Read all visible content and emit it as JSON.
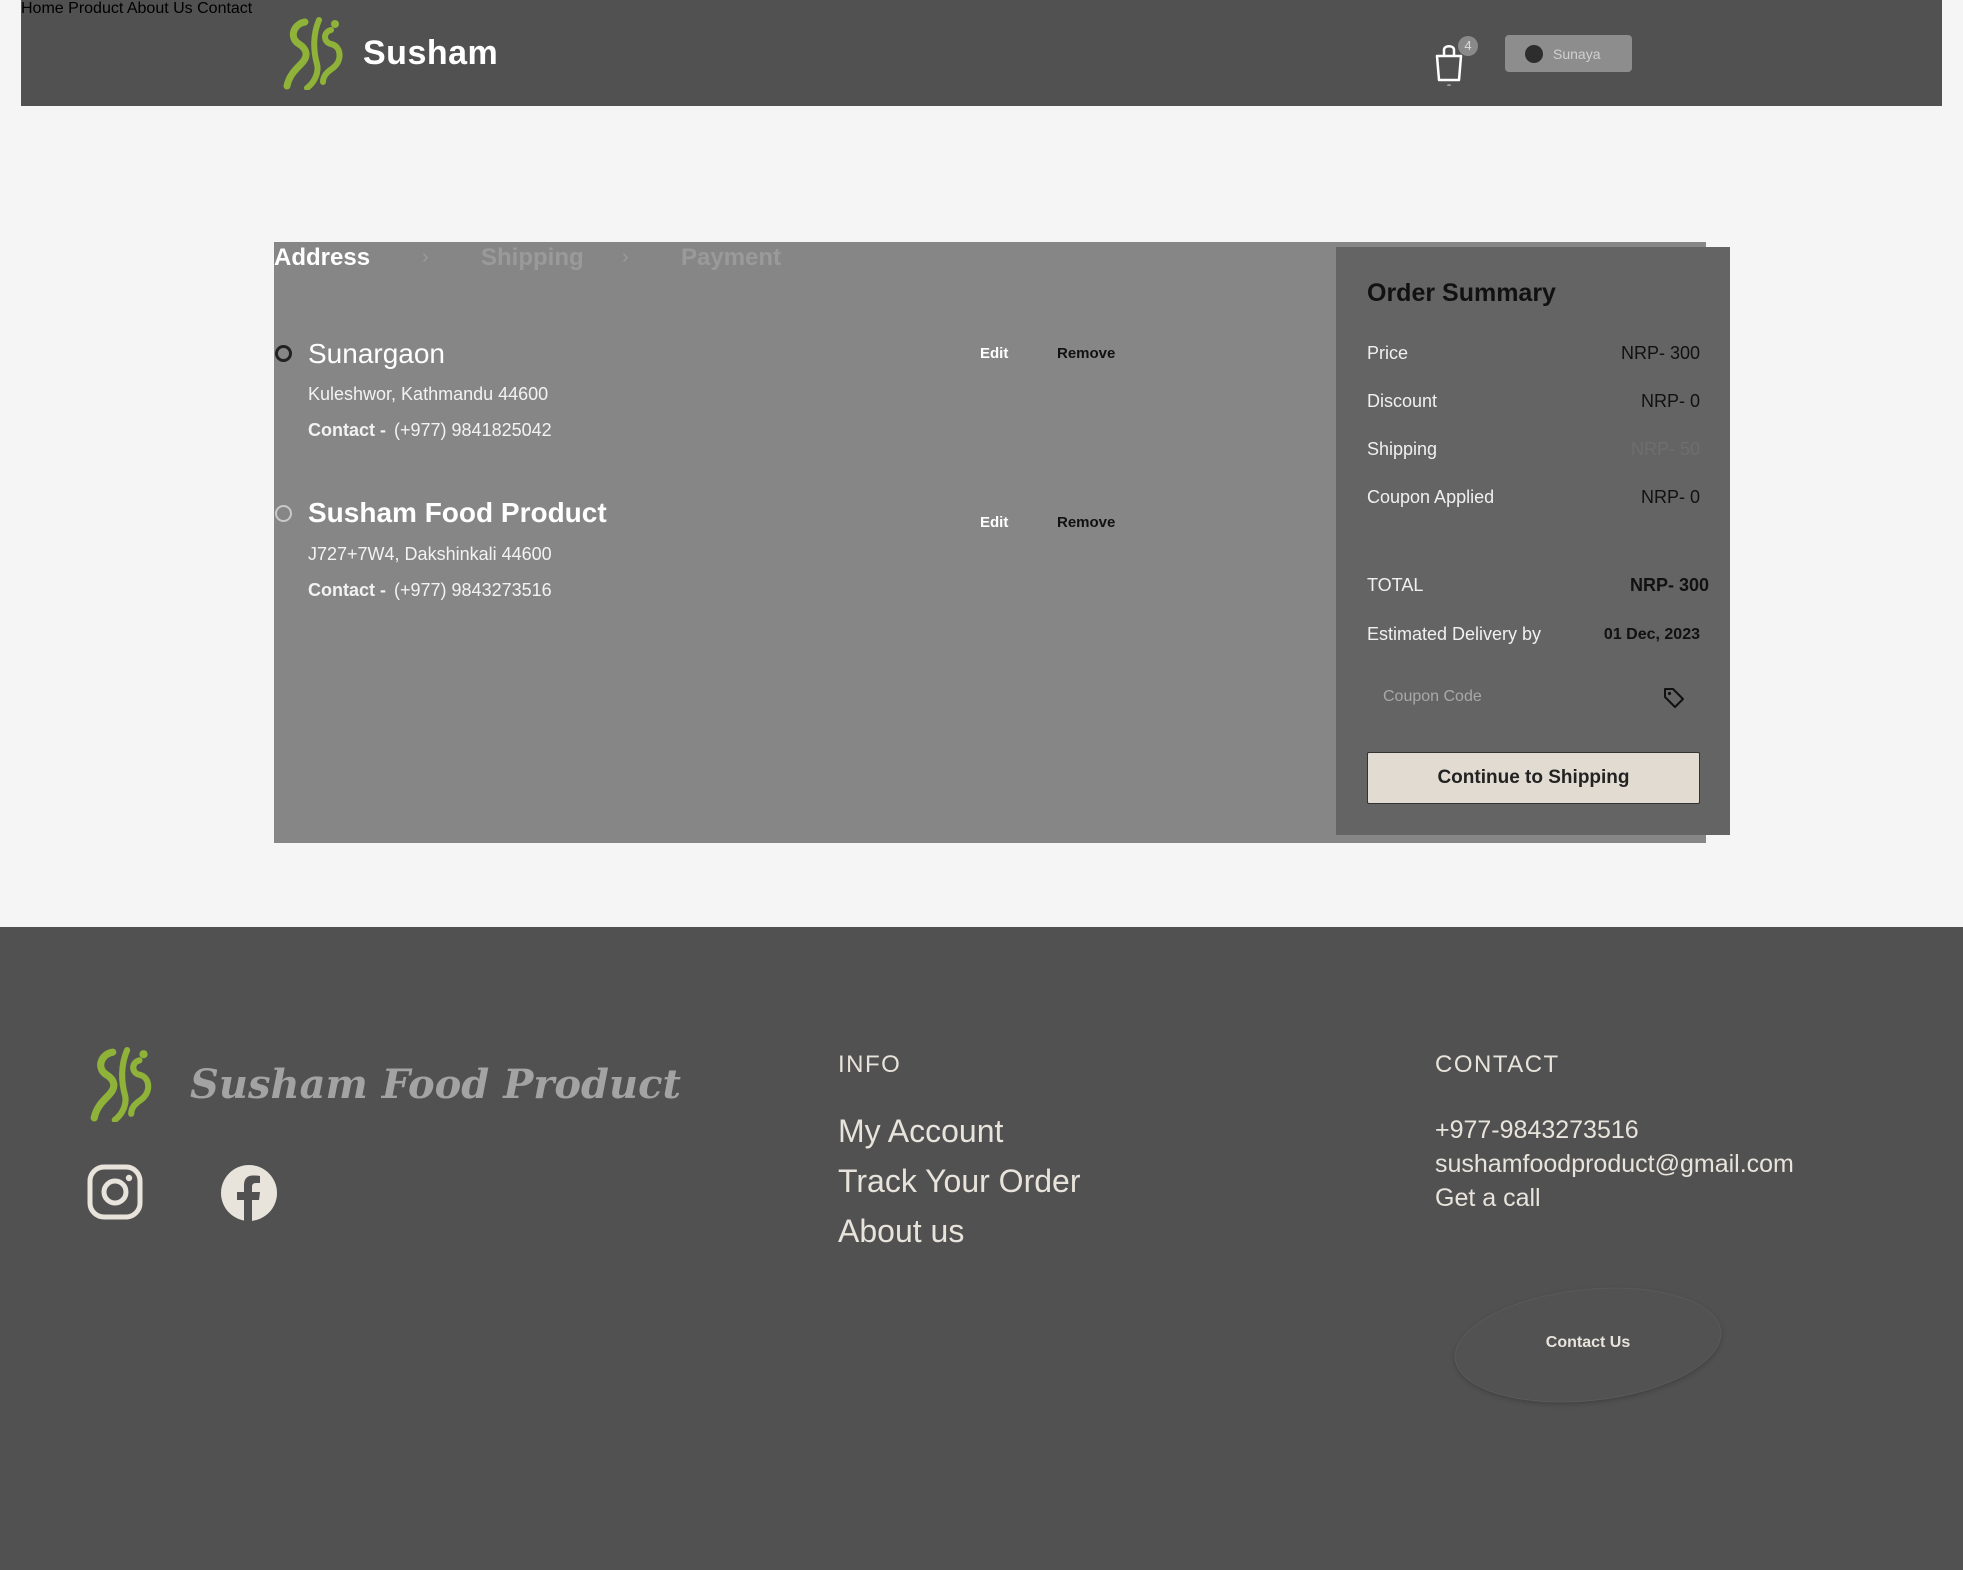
{
  "header": {
    "brand": "Susham",
    "nav": [
      "Home",
      "Product",
      "About Us",
      "Contact"
    ],
    "cart_count": "4",
    "user_name": "Sunaya"
  },
  "steps": {
    "active": "Address",
    "second": "Shipping",
    "third": "Payment",
    "separator": "›"
  },
  "addresses": [
    {
      "name": "Sunargaon",
      "line": "Kuleshwor, Kathmandu 44600",
      "contact_label": "Contact -",
      "contact_value": "(+977) 9841825042",
      "selected": true,
      "edit": "Edit",
      "remove": "Remove"
    },
    {
      "name": "Susham Food Product",
      "line": "J727+7W4, Dakshinkali 44600",
      "contact_label": "Contact -",
      "contact_value": "(+977) 9843273516",
      "selected": false,
      "edit": "Edit",
      "remove": "Remove"
    }
  ],
  "summary": {
    "title": "Order Summary",
    "price_label": "Price",
    "price_value": "NRP- 300",
    "discount_label": "Discount",
    "discount_value": "NRP- 0",
    "shipping_label": "Shipping",
    "shipping_value": "NRP- 50",
    "coupon_applied_label": "Coupon Applied",
    "coupon_applied_value": "NRP- 0",
    "total_label": "TOTAL",
    "total_value": "NRP- 300",
    "delivery_label": "Estimated Delivery by",
    "delivery_value": "01 Dec, 2023",
    "coupon_placeholder": "Coupon Code",
    "continue_label": "Continue to Shipping"
  },
  "footer": {
    "brand": "Susham Food Product",
    "info_heading": "INFO",
    "info_links": [
      "My Account",
      "Track Your Order",
      "About us"
    ],
    "contact_heading": "CONTACT",
    "phone": "+977-9843273516",
    "email": "sushamfoodproduct@gmail.com",
    "get_call": "Get a call",
    "contact_us": "Contact Us"
  },
  "colors": {
    "header_bg": "#515151",
    "panel_bg": "#868686",
    "summary_bg": "#646464",
    "brand_green": "#8fb339",
    "button_bg": "#e2dbd2"
  }
}
